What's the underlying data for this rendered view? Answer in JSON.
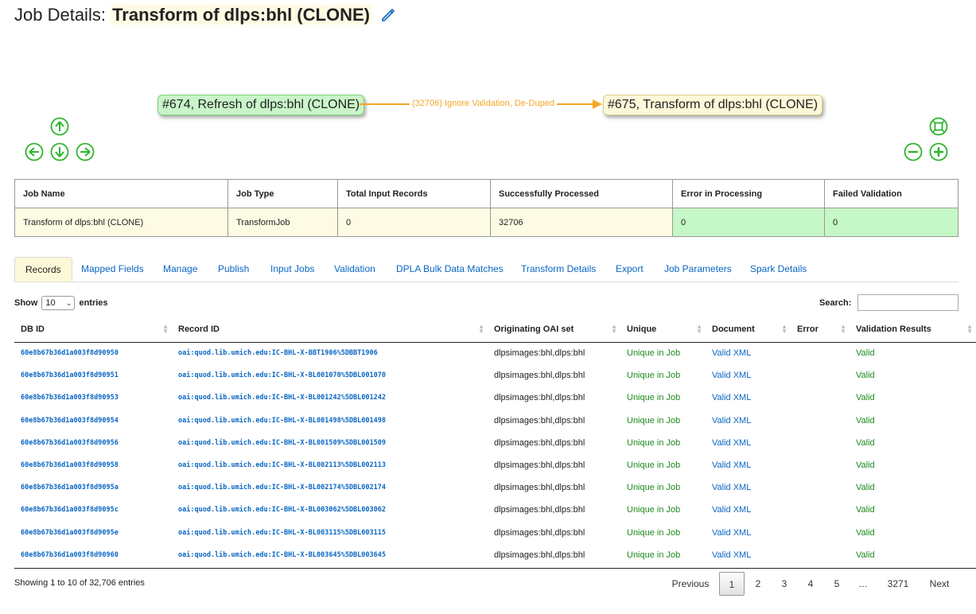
{
  "header": {
    "prefix": "Job Details:",
    "job_name": "Transform of dlps:bhl (CLONE)"
  },
  "graph": {
    "source_node": "#674, Refresh of dlps:bhl (CLONE)",
    "target_node": "#675, Transform of dlps:bhl (CLONE)",
    "edge_label": "(32706) Ignore Validation, De-Duped"
  },
  "summary": {
    "headers": [
      "Job Name",
      "Job Type",
      "Total Input Records",
      "Successfully Processed",
      "Error in Processing",
      "Failed Validation"
    ],
    "values": [
      "Transform of dlps:bhl (CLONE)",
      "TransformJob",
      "0",
      "32706",
      "0",
      "0"
    ]
  },
  "tabs": [
    "Records",
    "Mapped Fields",
    "Manage",
    "Publish",
    "Input Jobs",
    "Validation",
    "DPLA Bulk Data Matches",
    "Transform Details",
    "Export",
    "Job Parameters",
    "Spark Details"
  ],
  "controls": {
    "show_label": "Show",
    "show_value": "10",
    "entries_label": "entries",
    "search_label": "Search:"
  },
  "table": {
    "headers": [
      "DB ID",
      "Record ID",
      "Originating OAI set",
      "Unique",
      "Document",
      "Error",
      "Validation Results"
    ],
    "rows": [
      {
        "db_id": "60e8b67b36d1a003f8d90950",
        "record_id": "oai:quod.lib.umich.edu:IC-BHL-X-BBT1906%5DBBT1906",
        "oai_set": "dlpsimages:bhl,dlps:bhl",
        "unique": "Unique in Job",
        "document": "Valid XML",
        "error": "",
        "validation": "Valid"
      },
      {
        "db_id": "60e8b67b36d1a003f8d90951",
        "record_id": "oai:quod.lib.umich.edu:IC-BHL-X-BL001070%5DBL001070",
        "oai_set": "dlpsimages:bhl,dlps:bhl",
        "unique": "Unique in Job",
        "document": "Valid XML",
        "error": "",
        "validation": "Valid"
      },
      {
        "db_id": "60e8b67b36d1a003f8d90953",
        "record_id": "oai:quod.lib.umich.edu:IC-BHL-X-BL001242%5DBL001242",
        "oai_set": "dlpsimages:bhl,dlps:bhl",
        "unique": "Unique in Job",
        "document": "Valid XML",
        "error": "",
        "validation": "Valid"
      },
      {
        "db_id": "60e8b67b36d1a003f8d90954",
        "record_id": "oai:quod.lib.umich.edu:IC-BHL-X-BL001498%5DBL001498",
        "oai_set": "dlpsimages:bhl,dlps:bhl",
        "unique": "Unique in Job",
        "document": "Valid XML",
        "error": "",
        "validation": "Valid"
      },
      {
        "db_id": "60e8b67b36d1a003f8d90956",
        "record_id": "oai:quod.lib.umich.edu:IC-BHL-X-BL001509%5DBL001509",
        "oai_set": "dlpsimages:bhl,dlps:bhl",
        "unique": "Unique in Job",
        "document": "Valid XML",
        "error": "",
        "validation": "Valid"
      },
      {
        "db_id": "60e8b67b36d1a003f8d90958",
        "record_id": "oai:quod.lib.umich.edu:IC-BHL-X-BL002113%5DBL002113",
        "oai_set": "dlpsimages:bhl,dlps:bhl",
        "unique": "Unique in Job",
        "document": "Valid XML",
        "error": "",
        "validation": "Valid"
      },
      {
        "db_id": "60e8b67b36d1a003f8d9095a",
        "record_id": "oai:quod.lib.umich.edu:IC-BHL-X-BL002174%5DBL002174",
        "oai_set": "dlpsimages:bhl,dlps:bhl",
        "unique": "Unique in Job",
        "document": "Valid XML",
        "error": "",
        "validation": "Valid"
      },
      {
        "db_id": "60e8b67b36d1a003f8d9095c",
        "record_id": "oai:quod.lib.umich.edu:IC-BHL-X-BL003062%5DBL003062",
        "oai_set": "dlpsimages:bhl,dlps:bhl",
        "unique": "Unique in Job",
        "document": "Valid XML",
        "error": "",
        "validation": "Valid"
      },
      {
        "db_id": "60e8b67b36d1a003f8d9095e",
        "record_id": "oai:quod.lib.umich.edu:IC-BHL-X-BL003115%5DBL003115",
        "oai_set": "dlpsimages:bhl,dlps:bhl",
        "unique": "Unique in Job",
        "document": "Valid XML",
        "error": "",
        "validation": "Valid"
      },
      {
        "db_id": "60e8b67b36d1a003f8d90960",
        "record_id": "oai:quod.lib.umich.edu:IC-BHL-X-BL003645%5DBL003645",
        "oai_set": "dlpsimages:bhl,dlps:bhl",
        "unique": "Unique in Job",
        "document": "Valid XML",
        "error": "",
        "validation": "Valid"
      }
    ]
  },
  "info": "Showing 1 to 10 of 32,706 entries",
  "pagination": {
    "previous": "Previous",
    "pages": [
      "1",
      "2",
      "3",
      "4",
      "5",
      "…",
      "3271"
    ],
    "current": "1",
    "next": "Next"
  },
  "colors": {
    "accent_link": "#0a66c2",
    "success_green": "#1c8a1c",
    "edge_orange": "#f5a623",
    "highlight_yellow": "#fdfbe3",
    "ok_cell_green": "#c6f7c6"
  }
}
